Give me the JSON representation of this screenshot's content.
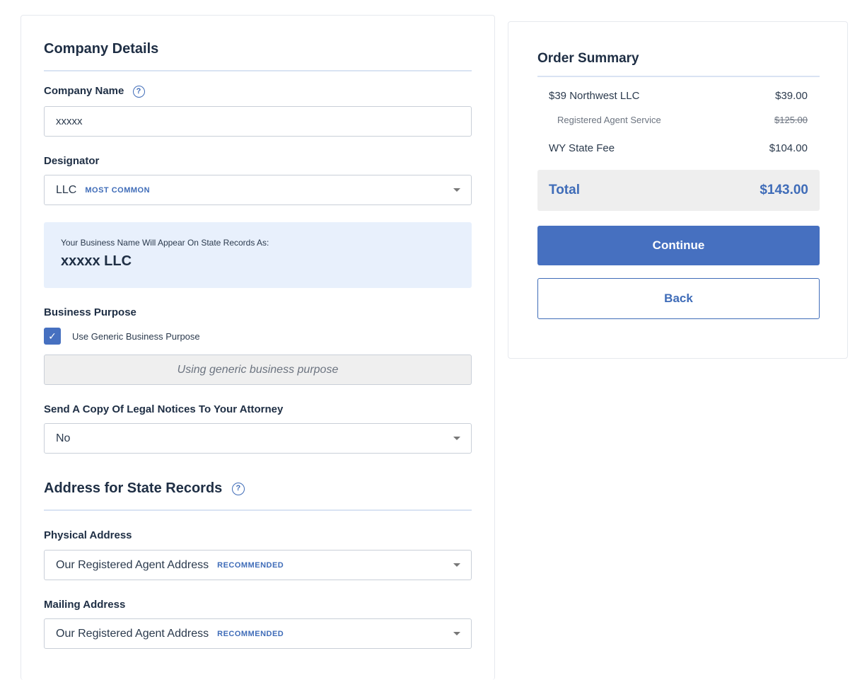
{
  "company_details": {
    "title": "Company Details",
    "company_name_label": "Company Name",
    "company_name_value": "xxxxx",
    "designator_label": "Designator",
    "designator_value": "LLC",
    "designator_tag": "MOST COMMON",
    "preview_caption": "Your Business Name Will Appear On State Records As:",
    "preview_name": "xxxxx LLC",
    "business_purpose_label": "Business Purpose",
    "generic_purpose_checkbox_label": "Use Generic Business Purpose",
    "generic_purpose_checked": true,
    "generic_purpose_text": "Using generic business purpose",
    "attorney_label": "Send A Copy Of Legal Notices To Your Attorney",
    "attorney_value": "No"
  },
  "address": {
    "title": "Address for State Records",
    "physical_label": "Physical Address",
    "physical_value": "Our Registered Agent Address",
    "physical_tag": "RECOMMENDED",
    "mailing_label": "Mailing Address",
    "mailing_value": "Our Registered Agent Address",
    "mailing_tag": "RECOMMENDED"
  },
  "order_summary": {
    "title": "Order Summary",
    "items": [
      {
        "label": "$39 Northwest LLC",
        "price": "$39.00"
      },
      {
        "label": "Registered Agent Service",
        "price": "$125.00"
      },
      {
        "label": "WY State Fee",
        "price": "$104.00"
      }
    ],
    "total_label": "Total",
    "total_value": "$143.00",
    "continue_label": "Continue",
    "back_label": "Back"
  },
  "colors": {
    "accent": "#4670c0",
    "preview_bg": "#e8f0fc",
    "divider": "#d9e3f3"
  },
  "icons": {
    "help": "help-circle-icon",
    "check": "check-icon",
    "caret": "caret-down-icon"
  }
}
